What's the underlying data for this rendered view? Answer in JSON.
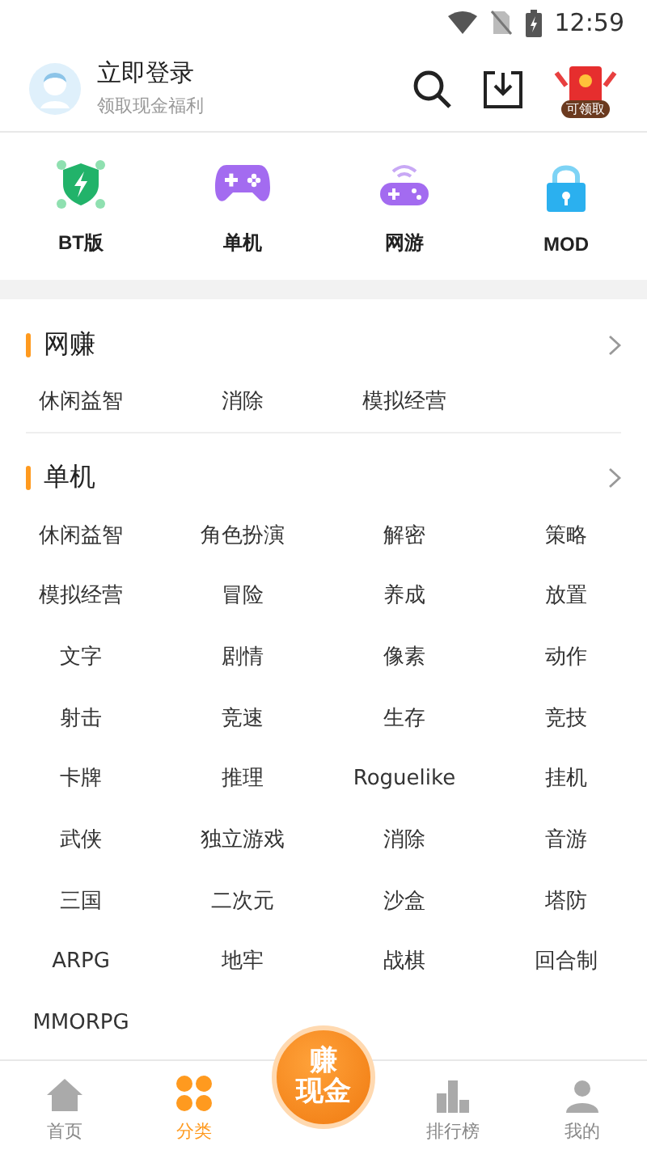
{
  "status_bar": {
    "time": "12:59"
  },
  "header": {
    "title": "立即登录",
    "subtitle": "领取现金福利",
    "reward_badge": "可领取"
  },
  "quick_categories": [
    {
      "kind": "bt",
      "label": "BT版"
    },
    {
      "kind": "single",
      "label": "单机"
    },
    {
      "kind": "online",
      "label": "网游"
    },
    {
      "kind": "mod",
      "label": "MOD"
    }
  ],
  "sections": [
    {
      "title": "网赚",
      "tags": [
        "休闲益智",
        "消除",
        "模拟经营"
      ]
    },
    {
      "title": "单机",
      "tags": [
        "休闲益智",
        "角色扮演",
        "解密",
        "策略",
        "模拟经营",
        "冒险",
        "养成",
        "放置",
        "文字",
        "剧情",
        "像素",
        "动作",
        "射击",
        "竞速",
        "生存",
        "竞技",
        "卡牌",
        "推理",
        "Roguelike",
        "挂机",
        "武侠",
        "独立游戏",
        "消除",
        "音游",
        "三国",
        "二次元",
        "沙盒",
        "塔防",
        "ARPG",
        "地牢",
        "战棋",
        "回合制",
        "MMORPG"
      ]
    }
  ],
  "bottom_nav": [
    {
      "kind": "home",
      "label": "首页",
      "selected": false
    },
    {
      "kind": "grid",
      "label": "分类",
      "selected": true
    },
    {
      "kind": "earn",
      "label_lines": [
        "赚",
        "现金"
      ]
    },
    {
      "kind": "rank",
      "label": "排行榜",
      "selected": false
    },
    {
      "kind": "me",
      "label": "我的",
      "selected": false
    }
  ]
}
